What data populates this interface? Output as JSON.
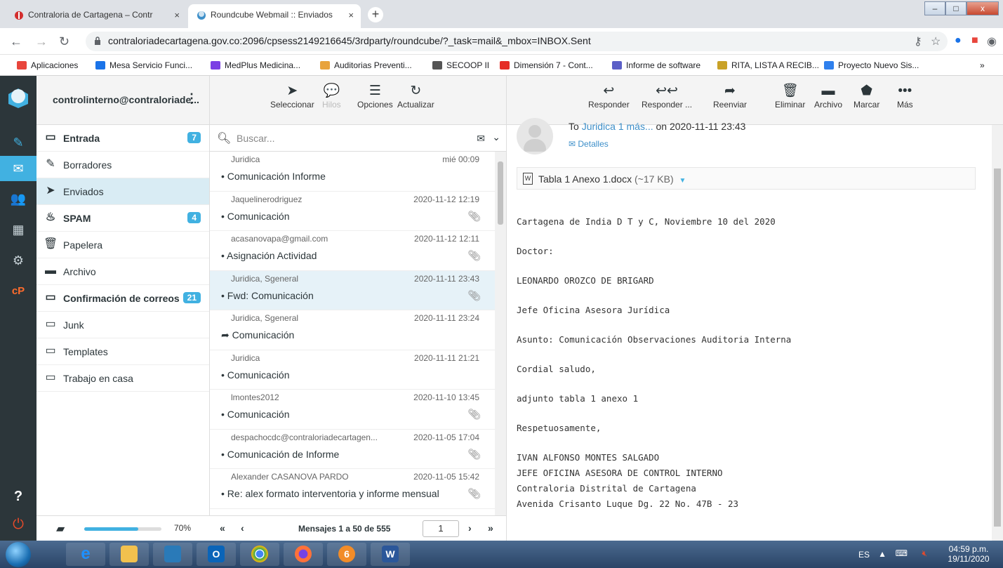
{
  "browser": {
    "tabs": [
      {
        "title": "Contraloria de Cartagena – Contr",
        "close": "×"
      },
      {
        "title": "Roundcube Webmail :: Enviados",
        "close": "×"
      }
    ],
    "new_tab": "+",
    "url": "contraloriadecartagena.gov.co:2096/cpsess2149216645/3rdparty/roundcube/?_task=mail&_mbox=INBOX.Sent",
    "window_buttons": {
      "minimize": "–",
      "maximize": "□",
      "close": "x"
    },
    "bookmarks": [
      {
        "label": "Aplicaciones",
        "color": "#e8453c"
      },
      {
        "label": "Mesa Servicio Funci...",
        "color": "#1a73e8"
      },
      {
        "label": "MedPlus Medicina...",
        "color": "#7b3fe4"
      },
      {
        "label": "Auditorias Preventi...",
        "color": "#e8a33c"
      },
      {
        "label": "SECOOP II",
        "color": "#555555"
      },
      {
        "label": "Dimensión 7 - Cont...",
        "color": "#e52d27"
      },
      {
        "label": "Informe de software",
        "color": "#5b5fc7"
      },
      {
        "label": "RITA, LISTA A RECIB...",
        "color": "#c9a227"
      },
      {
        "label": "Proyecto Nuevo Sis...",
        "color": "#2f80ed"
      }
    ],
    "more": "»"
  },
  "account": "controlinterno@contraloriade...",
  "folders": [
    {
      "name": "Entrada",
      "icon": "inbox-icon",
      "glyph": "▭",
      "badge": "7",
      "bold": true
    },
    {
      "name": "Borradores",
      "icon": "pencil-icon",
      "glyph": "✎",
      "badge": "",
      "bold": false
    },
    {
      "name": "Enviados",
      "icon": "send-icon",
      "glyph": "➤",
      "badge": "",
      "bold": false,
      "selected": true
    },
    {
      "name": "SPAM",
      "icon": "fire-icon",
      "glyph": "♨",
      "badge": "4",
      "bold": true
    },
    {
      "name": "Papelera",
      "icon": "trash-icon",
      "glyph": "🗑",
      "badge": "",
      "bold": false
    },
    {
      "name": "Archivo",
      "icon": "archive-icon",
      "glyph": "▬",
      "badge": "",
      "bold": false
    },
    {
      "name": "Confirmación de correos",
      "icon": "folder-icon",
      "glyph": "▭",
      "badge": "21",
      "bold": true
    },
    {
      "name": "Junk",
      "icon": "folder-icon",
      "glyph": "▭",
      "badge": "",
      "bold": false
    },
    {
      "name": "Templates",
      "icon": "folder-icon",
      "glyph": "▭",
      "badge": "",
      "bold": false
    },
    {
      "name": "Trabajo en casa",
      "icon": "folder-icon",
      "glyph": "▭",
      "badge": "",
      "bold": false
    }
  ],
  "quota": {
    "percent": 70,
    "label": "70%"
  },
  "list_toolbar": {
    "select": "Seleccionar",
    "threads": "Hilos",
    "options": "Opciones",
    "refresh": "Actualizar"
  },
  "search": {
    "placeholder": "Buscar..."
  },
  "messages": [
    {
      "from": "Juridica",
      "date": "mié 00:09",
      "subject": "Comunicación Informe",
      "attach": false,
      "prefix": "•"
    },
    {
      "from": "Jaquelinerodriguez",
      "date": "2020-11-12 12:19",
      "subject": "Comunicación",
      "attach": true,
      "prefix": "•"
    },
    {
      "from": "acasanovapa@gmail.com",
      "date": "2020-11-12 12:11",
      "subject": "Asignación Actividad",
      "attach": true,
      "prefix": "•"
    },
    {
      "from": "Juridica, Sgeneral",
      "date": "2020-11-11 23:43",
      "subject": "Fwd: Comunicación",
      "attach": true,
      "prefix": "•",
      "selected": true
    },
    {
      "from": "Juridica, Sgeneral",
      "date": "2020-11-11 23:24",
      "subject": "Comunicación",
      "attach": false,
      "prefix": "➦"
    },
    {
      "from": "Juridica",
      "date": "2020-11-11 21:21",
      "subject": "Comunicación",
      "attach": false,
      "prefix": "•"
    },
    {
      "from": "lmontes2012",
      "date": "2020-11-10 13:45",
      "subject": "Comunicación",
      "attach": true,
      "prefix": "•"
    },
    {
      "from": "despachocdc@contraloriadecartagen...",
      "date": "2020-11-05 17:04",
      "subject": "Comunicación de Informe",
      "attach": true,
      "prefix": "•"
    },
    {
      "from": "Alexander CASANOVA PARDO",
      "date": "2020-11-05 15:42",
      "subject": "Re: alex formato interventoria y informe mensual",
      "attach": true,
      "prefix": "•"
    },
    {
      "from": "",
      "date": "",
      "subject": "",
      "attach": false,
      "prefix": ""
    }
  ],
  "pagination": {
    "count": "Mensajes 1 a 50 de 555",
    "page": "1",
    "first": "«",
    "prev": "‹",
    "next": "›",
    "last": "»"
  },
  "reader_toolbar": {
    "reply": "Responder",
    "reply_all": "Responder ...",
    "forward": "Reenviar",
    "delete": "Eliminar",
    "archive": "Archivo",
    "mark": "Marcar",
    "more": "Más"
  },
  "reader": {
    "to_prefix": "To ",
    "to_link": "Juridica 1 más...",
    "to_suffix": " on 2020-11-11 23:43",
    "details": "Detalles",
    "attachment_name": "Tabla 1 Anexo 1.docx",
    "attachment_size": "(~17 KB)",
    "body_lines": [
      "Cartagena de India D T y C, Noviembre 10 del 2020",
      "Doctor:",
      "LEONARDO OROZCO DE BRIGARD",
      "Jefe Oficina Asesora Jurídica",
      "Asunto: Comunicación Observaciones Auditoria Interna",
      "Cordial saludo,",
      "adjunto tabla 1 anexo 1",
      "Respetuosamente,",
      "IVAN ALFONSO MONTES SALGADO",
      "JEFE OFICINA ASESORA DE CONTROL INTERNO",
      "Contraloria Distrital de Cartagena",
      "Avenida Crisanto Luque Dg. 22 No. 47B - 23"
    ]
  },
  "taskbar": {
    "lang": "ES",
    "time": "04:59 p.m.",
    "date": "19/11/2020"
  }
}
